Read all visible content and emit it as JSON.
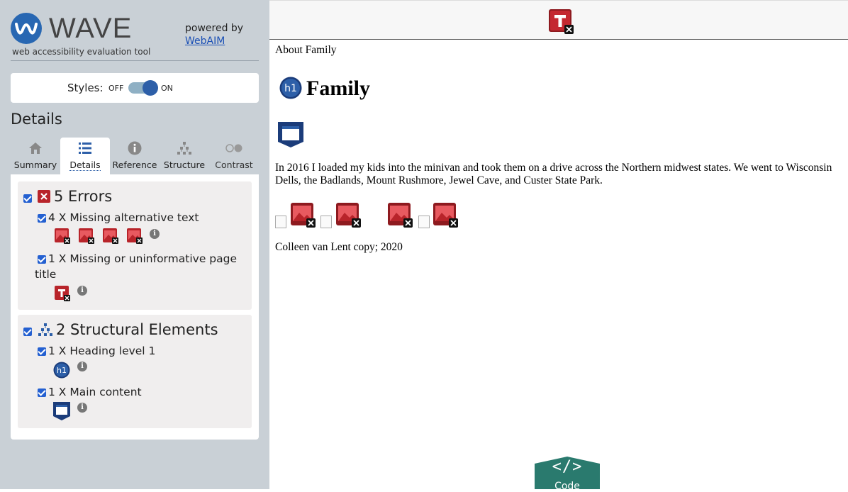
{
  "logo": {
    "word": "WAVE",
    "subtitle": "web accessibility evaluation tool"
  },
  "powered": {
    "text": "powered by",
    "link": "WebAIM"
  },
  "styles": {
    "label": "Styles:",
    "off": "OFF",
    "on": "ON"
  },
  "details_heading": "Details",
  "tabs": [
    {
      "label": "Summary",
      "icon": "home-icon"
    },
    {
      "label": "Details",
      "icon": "list-icon"
    },
    {
      "label": "Reference",
      "icon": "info-icon"
    },
    {
      "label": "Structure",
      "icon": "structure-icon"
    },
    {
      "label": "Contrast",
      "icon": "contrast-icon"
    }
  ],
  "errors": {
    "title": "5 Errors",
    "items": [
      {
        "text": "4 X Missing alternative text"
      },
      {
        "text": "1 X Missing or uninformative page title"
      }
    ]
  },
  "structure": {
    "title": "2 Structural Elements",
    "items": [
      {
        "text": "1 X Heading level 1"
      },
      {
        "text": "1 X Main content"
      }
    ]
  },
  "page": {
    "title_text": "About Family",
    "heading": "Family",
    "h1_badge": "h1",
    "paragraph": "In 2016 I loaded my kids into the minivan and took them on a drive across the Northern midwest states. We went to Wisconsin Dells, the Badlands, Mount Rushmore, Jewel Cave, and Custer State Park.",
    "footer": "Colleen van Lent copy; 2020"
  },
  "code_button": {
    "label": "Code",
    "symbol": "</>"
  },
  "colors": {
    "error": "#b8242a",
    "accent": "#2d5fa8",
    "sidebar": "#c9d0d6",
    "code": "#2a7a6e"
  }
}
